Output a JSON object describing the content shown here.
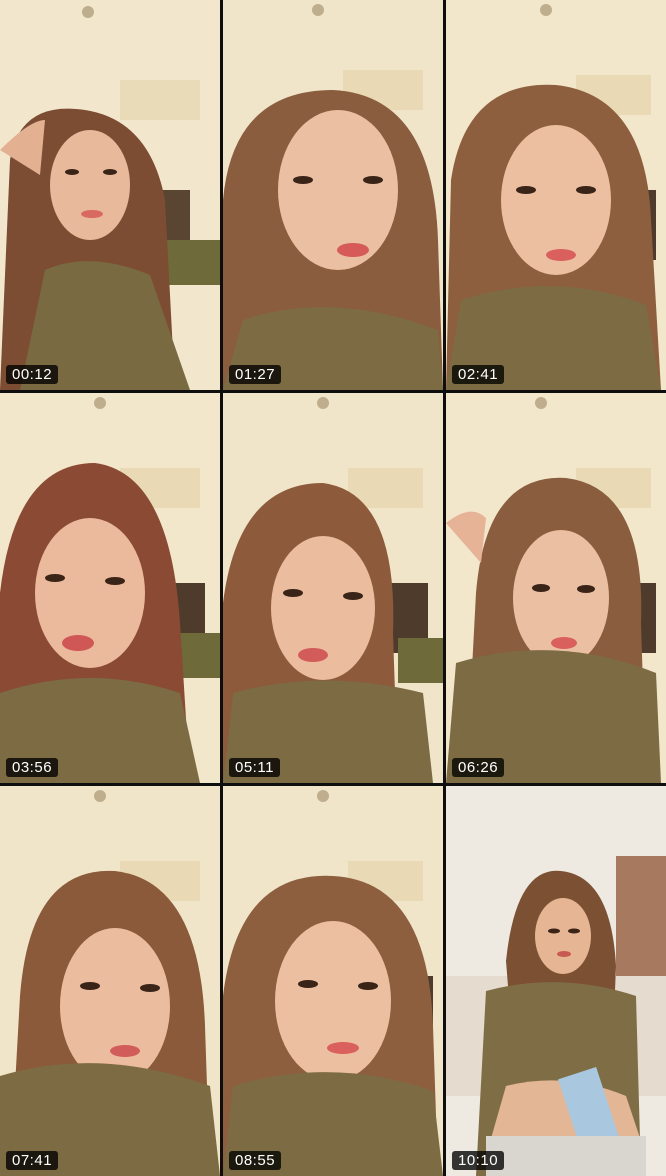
{
  "thumbnails": [
    {
      "timestamp": "00:12"
    },
    {
      "timestamp": "01:27"
    },
    {
      "timestamp": "02:41"
    },
    {
      "timestamp": "03:56"
    },
    {
      "timestamp": "05:11"
    },
    {
      "timestamp": "06:26"
    },
    {
      "timestamp": "07:41"
    },
    {
      "timestamp": "08:55"
    },
    {
      "timestamp": "10:10"
    }
  ],
  "colors": {
    "wall": "#f1e6cc",
    "hair": "#8a5a3a",
    "skin": "#e7b598",
    "top": "#7f6e45",
    "stamp_bg": "#000000",
    "stamp_text": "#ffffff"
  }
}
